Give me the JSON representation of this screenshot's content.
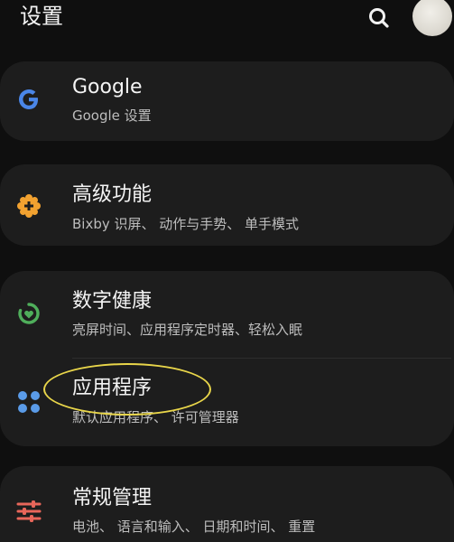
{
  "header": {
    "title": "设置",
    "search_icon": "search-icon",
    "avatar": "avatar"
  },
  "settings": [
    {
      "id": "google",
      "icon": "google-g-icon",
      "icon_color": "#4a86e8",
      "title": "Google",
      "subtitle": "Google 设置"
    },
    {
      "id": "advanced",
      "icon": "gear-plus-icon",
      "icon_color": "#f2a230",
      "title": "高级功能",
      "subtitle": "Bixby 识屏、 动作与手势、 单手模式"
    },
    {
      "id": "digital-wellbeing",
      "icon": "wellbeing-heart-icon",
      "icon_color": "#4fae5b",
      "title": "数字健康",
      "subtitle": "亮屏时间、应用程序定时器、轻松入眠"
    },
    {
      "id": "apps",
      "icon": "apps-dots-icon",
      "icon_color": "#5a9be8",
      "title": "应用程序",
      "subtitle": "默认应用程序、 许可管理器"
    },
    {
      "id": "general-management",
      "icon": "sliders-icon",
      "icon_color": "#e8665a",
      "title": "常规管理",
      "subtitle": "电池、 语言和输入、 日期和时间、 重置"
    }
  ],
  "annotation": {
    "highlight_color": "#e9d64a"
  }
}
